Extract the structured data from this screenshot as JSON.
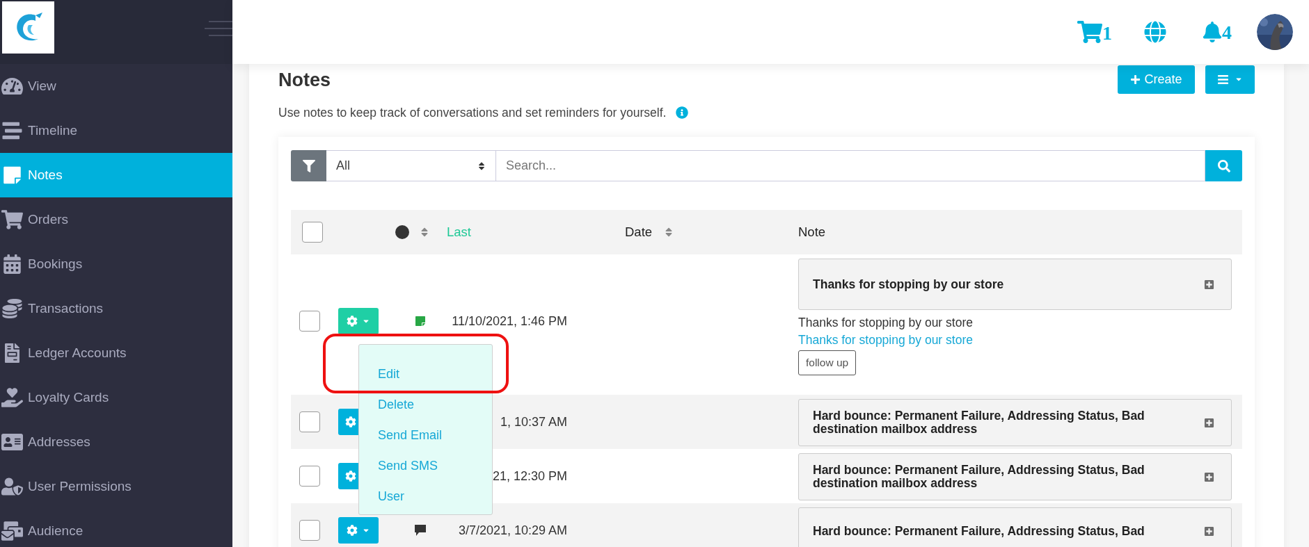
{
  "sidebar": {
    "items": [
      {
        "label": "View",
        "selected": false
      },
      {
        "label": "Timeline",
        "selected": false
      },
      {
        "label": "Notes",
        "selected": true
      },
      {
        "label": "Orders",
        "selected": false
      },
      {
        "label": "Bookings",
        "selected": false
      },
      {
        "label": "Transactions",
        "selected": false
      },
      {
        "label": "Ledger Accounts",
        "selected": false
      },
      {
        "label": "Loyalty Cards",
        "selected": false
      },
      {
        "label": "Addresses",
        "selected": false
      },
      {
        "label": "User Permissions",
        "selected": false
      },
      {
        "label": "Audience",
        "selected": false
      }
    ]
  },
  "header": {
    "cart_count": "1",
    "notification_count": "4"
  },
  "page": {
    "title": "Notes",
    "subtitle": "Use notes to keep track of conversations and set reminders for yourself.",
    "create_button": "Create"
  },
  "filter": {
    "select_value": "All",
    "search_placeholder": "Search..."
  },
  "table": {
    "columns": [
      {
        "label": "Last",
        "sorted": true
      },
      {
        "label": "Date",
        "sorted": false
      },
      {
        "label": "Note"
      }
    ],
    "header_checked": false,
    "rows": [
      {
        "checked": false,
        "menu_open": true,
        "kind": "note",
        "date": "11/10/2021, 1:46 PM",
        "note": {
          "title": "Thanks for stopping by our store",
          "body": "Thanks for stopping by our store",
          "link": "Thanks for stopping by our store",
          "tag": "follow up"
        },
        "menu": [
          {
            "label": "Edit",
            "highlighted": true
          },
          {
            "label": "Delete",
            "highlighted": false
          },
          {
            "label": "Send Email",
            "highlighted": false
          },
          {
            "label": "Send SMS",
            "highlighted": false
          },
          {
            "label": "User",
            "highlighted": false
          }
        ]
      },
      {
        "checked": false,
        "menu_open": false,
        "date": "1, 10:37 AM",
        "note": {
          "title": "Hard bounce: Permanent Failure, Addressing Status, Bad destination mailbox address"
        }
      },
      {
        "checked": false,
        "menu_open": false,
        "date": "21, 12:30 PM",
        "note": {
          "title": "Hard bounce: Permanent Failure, Addressing Status, Bad destination mailbox address"
        }
      },
      {
        "checked": false,
        "menu_open": false,
        "kind": "sms",
        "date": "3/7/2021, 10:29 AM",
        "note": {
          "title": "Hard bounce: Permanent Failure, Addressing Status, Bad"
        }
      }
    ]
  }
}
